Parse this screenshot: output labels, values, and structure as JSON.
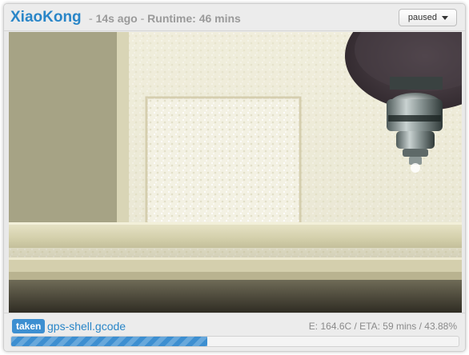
{
  "header": {
    "printer_name": "XiaoKong",
    "last_update": "14s ago",
    "runtime_text": "Runtime: 46 mins",
    "separator": "-",
    "state_button_label": "paused"
  },
  "camera": {
    "icon": "webcam-feed-image"
  },
  "job": {
    "status_badge": "taken",
    "filename": "gps-shell.gcode",
    "stats_text": "E: 164.6C / ETA: 59 mins / 43.88%",
    "progress_percent": 43.88
  },
  "colors": {
    "accent": "#2a86c8",
    "progress": "#3d8fd1",
    "muted_text": "#9a9a9a"
  }
}
